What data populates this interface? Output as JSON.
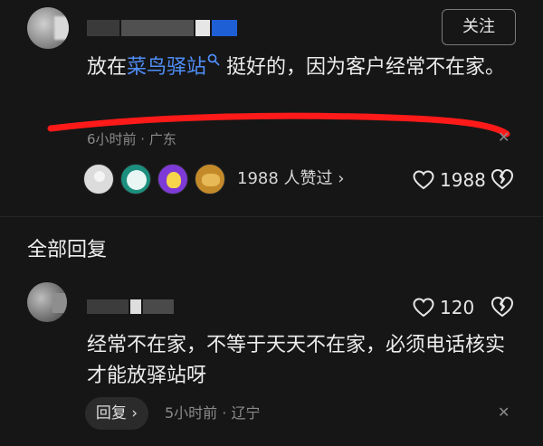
{
  "comment": {
    "follow_label": "关注",
    "text_before": "放在",
    "link_text": "菜鸟驿站",
    "text_after": " 挺好的，因为客户经常不在家。",
    "meta": "6小时前 · 广东",
    "likers_text": "1988 人赞过 ›",
    "like_count": "1988",
    "accent_link_color": "#4f8ef7"
  },
  "section": {
    "all_replies": "全部回复"
  },
  "reply": {
    "like_count": "120",
    "text": "经常不在家，不等于天天不在家，必须电话核实才能放驿站呀",
    "reply_button": "回复 ›",
    "meta": "5小时前 · 辽宁"
  },
  "icons": [
    "search-icon",
    "close-icon",
    "heart-icon",
    "broken-heart-icon"
  ]
}
